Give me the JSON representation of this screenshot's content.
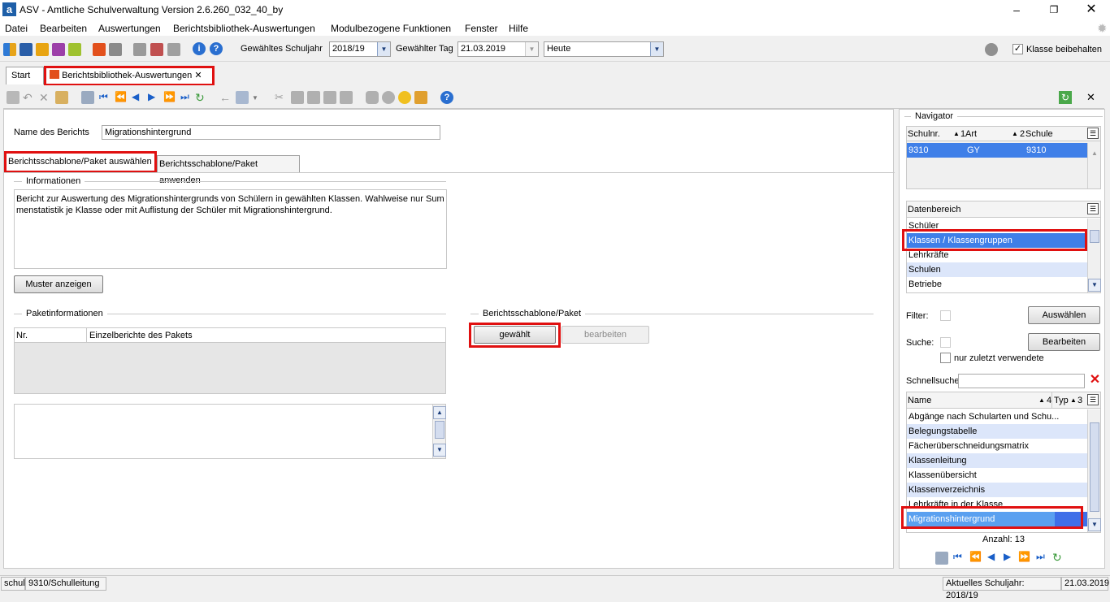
{
  "window": {
    "title": "ASV - Amtliche Schulverwaltung Version 2.6.260_032_40_by",
    "logo": "a"
  },
  "menubar": [
    "Datei",
    "Bearbeiten",
    "Auswertungen",
    "Berichtsbibliothek-Auswertungen",
    "Modulbezogene Funktionen",
    "Fenster",
    "Hilfe"
  ],
  "toolbar": {
    "schuljahr_label": "Gewähltes Schuljahr",
    "schuljahr_value": "2018/19",
    "tag_label": "Gewählter Tag",
    "tag_value": "21.03.2019",
    "heute_value": "Heute",
    "klasse_beibehalten_label": "Klasse beibehalten"
  },
  "tabs": [
    {
      "label": "Start",
      "active": false
    },
    {
      "label": "Berichtsbibliothek-Auswertungen",
      "active": true
    }
  ],
  "main": {
    "name_label": "Name des Berichts",
    "name_value": "Migrationshintergrund",
    "subtabs": [
      "Berichtsschablone/Paket auswählen",
      "Berichtsschablone/Paket anwenden"
    ],
    "informationen_title": "Informationen",
    "informationen_text": "Bericht zur Auswertung des Migrationshintergrunds von Schülern in gewählten Klassen. Wahlweise nur Sum menstatistik je Klasse oder mit Auflistung der Schüler mit Migrationshintergrund.",
    "muster_button": "Muster anzeigen",
    "paketinfo_title": "Paketinformationen",
    "paket_columns": [
      "Nr.",
      "Einzelberichte des Pakets"
    ],
    "schablone_title": "Berichtsschablone/Paket",
    "gewaehlt_button": "gewählt",
    "bearbeiten_button": "bearbeiten"
  },
  "navigator": {
    "title": "Navigator",
    "columns": [
      "Schulnr.",
      "Art",
      "Schule"
    ],
    "sort_markers": [
      "1",
      "2"
    ],
    "rows": [
      {
        "schulnr": "9310",
        "art": "GY",
        "schule": "9310"
      }
    ],
    "datenbereich_header": "Datenbereich",
    "datenbereich_items": [
      "Schüler",
      "Klassen / Klassengruppen",
      "Lehrkräfte",
      "Schulen",
      "Betriebe"
    ],
    "datenbereich_selected": 1,
    "filter_label": "Filter:",
    "suche_label": "Suche:",
    "auswaehlen_button": "Auswählen",
    "bearbeiten_button": "Bearbeiten",
    "nur_zuletzt_label": "nur zuletzt verwendete",
    "schnellsuche_label": "Schnellsuche",
    "list_columns": [
      "Name",
      "Typ"
    ],
    "list_sort_markers": [
      "4",
      "3"
    ],
    "list_items": [
      "Abgänge nach Schularten und Schu...",
      "Belegungstabelle",
      "Fächerüberschneidungsmatrix",
      "Klassenleitung",
      "Klassenübersicht",
      "Klassenverzeichnis",
      "Lehrkräfte in der Klasse",
      "Migrationshintergrund"
    ],
    "list_selected": 7,
    "anzahl": "Anzahl: 13"
  },
  "statusbar": {
    "user": "schul",
    "role": "9310/Schulleitung",
    "schuljahr": "Aktuelles Schuljahr: 2018/19",
    "date": "21.03.2019"
  },
  "colors": {
    "selection": "#3f7fe8",
    "highlight_border": "#e01010",
    "alt_row": "#dce6fa"
  }
}
